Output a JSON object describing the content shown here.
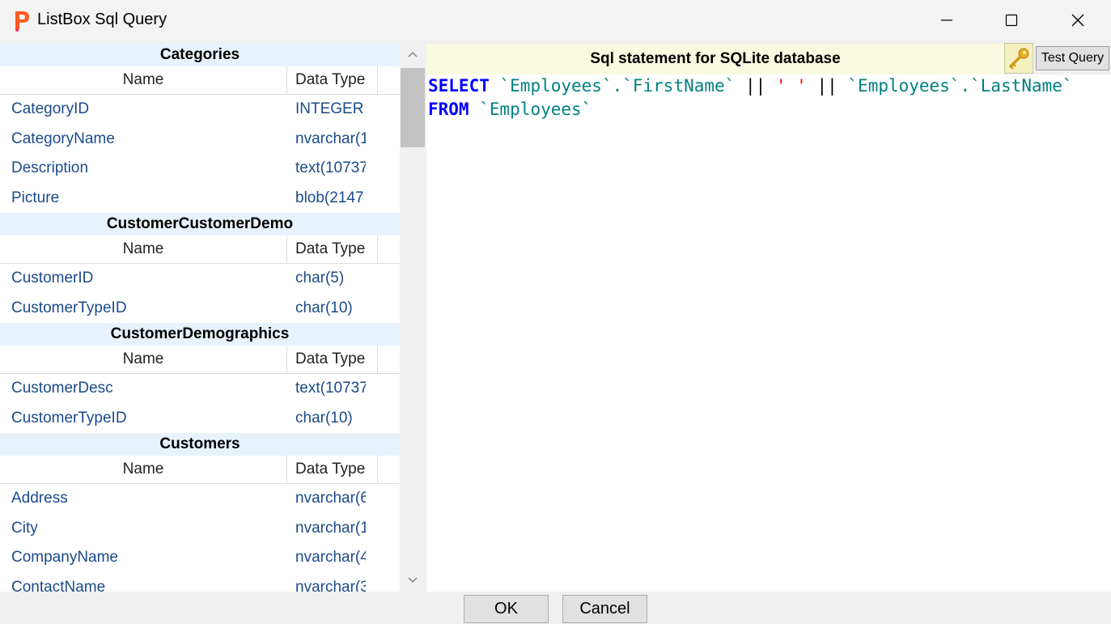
{
  "window": {
    "title": "ListBox Sql Query"
  },
  "tables": [
    {
      "name": "Categories",
      "col_name": "Name",
      "col_type": "Data Type",
      "rows": [
        {
          "name": "CategoryID",
          "type": "INTEGER"
        },
        {
          "name": "CategoryName",
          "type": "nvarchar(1"
        },
        {
          "name": "Description",
          "type": "text(10737"
        },
        {
          "name": "Picture",
          "type": "blob(2147"
        }
      ]
    },
    {
      "name": "CustomerCustomerDemo",
      "col_name": "Name",
      "col_type": "Data Type",
      "rows": [
        {
          "name": "CustomerID",
          "type": "char(5)"
        },
        {
          "name": "CustomerTypeID",
          "type": "char(10)"
        }
      ]
    },
    {
      "name": "CustomerDemographics",
      "col_name": "Name",
      "col_type": "Data Type",
      "rows": [
        {
          "name": "CustomerDesc",
          "type": "text(10737"
        },
        {
          "name": "CustomerTypeID",
          "type": "char(10)"
        }
      ]
    },
    {
      "name": "Customers",
      "col_name": "Name",
      "col_type": "Data Type",
      "rows": [
        {
          "name": "Address",
          "type": "nvarchar(6"
        },
        {
          "name": "City",
          "type": "nvarchar(1"
        },
        {
          "name": "CompanyName",
          "type": "nvarchar(4"
        },
        {
          "name": "ContactName",
          "type": "nvarchar(3"
        }
      ]
    }
  ],
  "sql_panel": {
    "header": "Sql statement for SQLite database",
    "test_button": "Test Query",
    "key_icon": "key-icon",
    "lines": [
      [
        {
          "t": "kw",
          "v": "SELECT"
        },
        {
          "t": "op",
          "v": " "
        },
        {
          "t": "ident",
          "v": "`Employees`.`FirstName`"
        },
        {
          "t": "op",
          "v": " || "
        },
        {
          "t": "str",
          "v": "' '"
        },
        {
          "t": "op",
          "v": " || "
        },
        {
          "t": "ident",
          "v": "`Employees`.`LastName`"
        }
      ],
      [
        {
          "t": "kw",
          "v": "FROM"
        },
        {
          "t": "op",
          "v": " "
        },
        {
          "t": "ident",
          "v": "`Employees`"
        }
      ]
    ]
  },
  "buttons": {
    "ok": "OK",
    "cancel": "Cancel"
  },
  "colors": {
    "table_header_bg": "#e8f2fd",
    "sql_header_bg": "#fafae0",
    "keyword": "#0000ff",
    "identifier": "#008080",
    "string": "#ff0000",
    "row_text": "#1a4a8a"
  }
}
